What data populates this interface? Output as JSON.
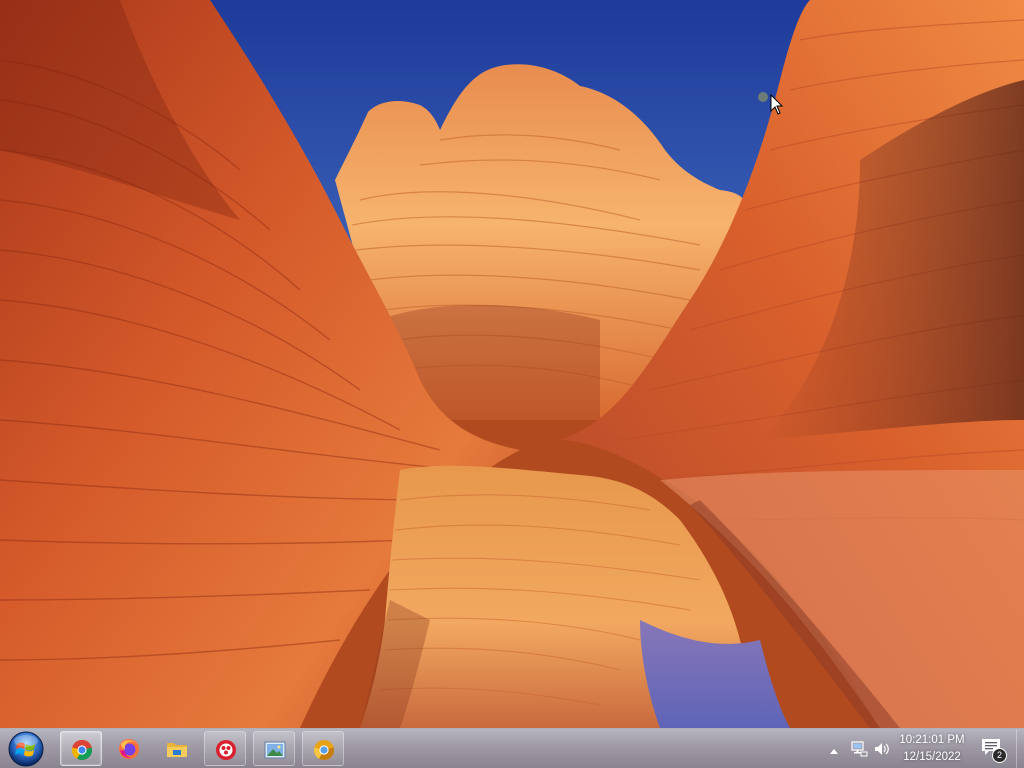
{
  "desktop": {
    "wallpaper": "the-wave-sandstone",
    "colors": {
      "sky": "#2f4fa8",
      "rock_light": "#f2a45a",
      "rock_mid": "#d65a28",
      "rock_dark": "#8e2a12"
    }
  },
  "taskbar": {
    "start_button": {
      "icon": "windows-logo-icon"
    },
    "apps": [
      {
        "name": "Google Chrome",
        "icon": "chrome-icon",
        "state": "active"
      },
      {
        "name": "Firefox",
        "icon": "firefox-icon",
        "state": "pinned"
      },
      {
        "name": "File Explorer",
        "icon": "folder-icon",
        "state": "pinned"
      },
      {
        "name": "Paint",
        "icon": "paint-palette-icon",
        "state": "open"
      },
      {
        "name": "Photo Viewer",
        "icon": "picture-icon",
        "state": "open"
      },
      {
        "name": "Chrome Canary",
        "icon": "chrome-canary-icon",
        "state": "open"
      }
    ],
    "tray": {
      "overflow_icon": "show-hidden-icons-arrow",
      "network_icon": "network-icon",
      "volume_icon": "speaker-icon"
    },
    "clock": {
      "time": "10:21:01 PM",
      "date": "12/15/2022"
    },
    "action_center": {
      "icon": "action-center-icon",
      "count": "2"
    }
  }
}
